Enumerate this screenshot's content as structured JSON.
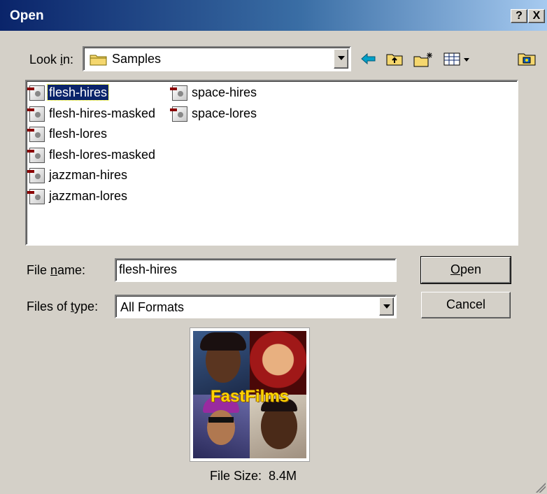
{
  "window": {
    "title": "Open",
    "help_label": "?",
    "close_label": "X"
  },
  "look_in": {
    "label_pre": "Look ",
    "label_key": "i",
    "label_post": "n:",
    "value": "Samples"
  },
  "toolbar": {
    "icons": [
      "back-arrow-icon",
      "up-folder-icon",
      "new-folder-icon",
      "view-menu-icon",
      "desktop-folder-icon"
    ]
  },
  "files": {
    "column1": [
      "flesh-hires",
      "flesh-hires-masked",
      "flesh-lores",
      "flesh-lores-masked",
      "jazzman-hires",
      "jazzman-lores"
    ],
    "column2": [
      "space-hires",
      "space-lores"
    ],
    "selected": "flesh-hires"
  },
  "file_name": {
    "label_pre": "File ",
    "label_key": "n",
    "label_post": "ame:",
    "value": "flesh-hires"
  },
  "files_of_type": {
    "label_pre": "Files of ",
    "label_key": "t",
    "label_post": "ype:",
    "value": "All Formats"
  },
  "buttons": {
    "open_key": "O",
    "open_rest": "pen",
    "cancel": "Cancel"
  },
  "preview": {
    "logo_text": "FastFilms",
    "file_size_text": "File Size:  8.4M"
  },
  "colors": {
    "title_start": "#0a246a",
    "title_end": "#a6caf0",
    "face": "#d4d0c8",
    "selection": "#0a246a"
  }
}
